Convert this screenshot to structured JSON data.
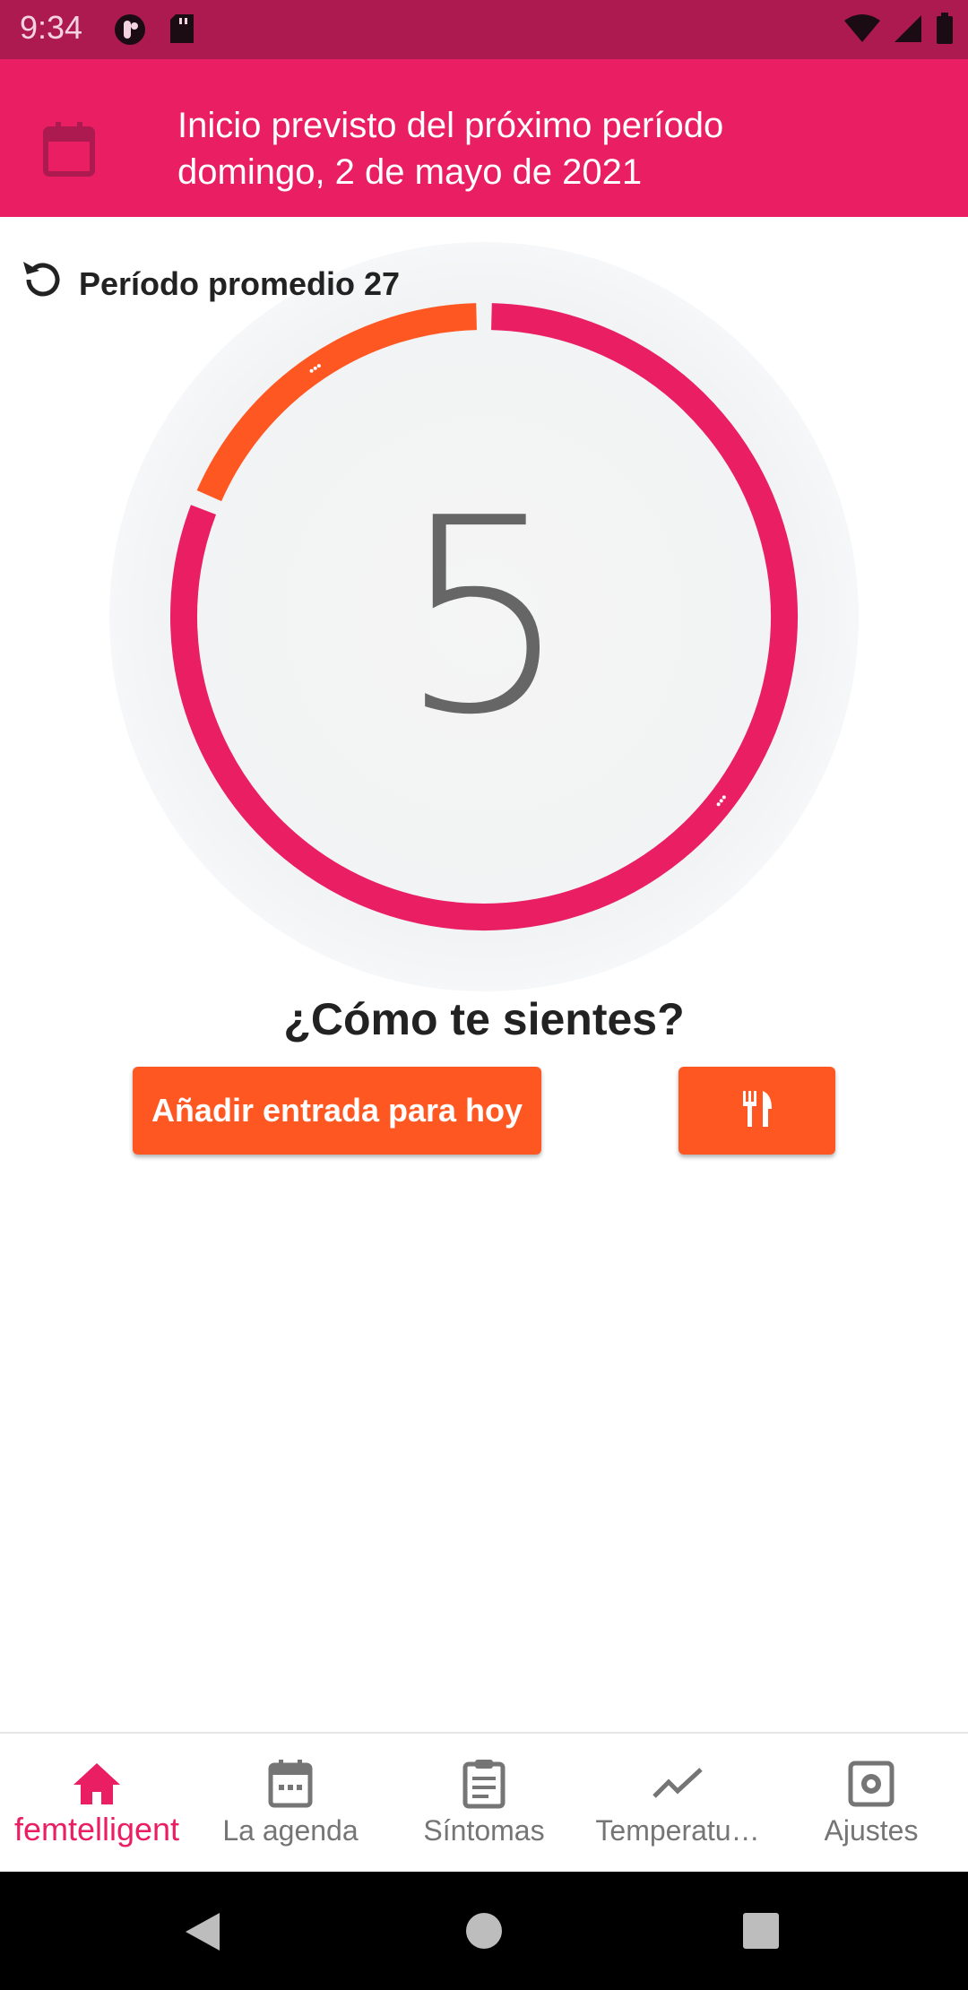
{
  "status_bar": {
    "time": "9:34",
    "icons_left": [
      "opera-icon",
      "sd-card-icon"
    ],
    "icons_right": [
      "wifi-icon",
      "signal-icon",
      "battery-icon"
    ]
  },
  "header": {
    "icon": "calendar-icon",
    "line1": "Inicio previsto del próximo período",
    "line2": "domingo, 2 de mayo de 2021"
  },
  "cycle": {
    "average_label": "Período promedio 27",
    "current_day": "5",
    "cycle_length_days": 27,
    "fertile_window_fraction_start": 0.812,
    "fertile_window_fraction_end": 1.0
  },
  "question": "¿Cómo te sientes?",
  "actions": {
    "add_entry_label": "Añadir entrada para hoy",
    "food_icon": "fork-knife-icon"
  },
  "bottom_nav": {
    "items": [
      {
        "label": "femtelligent",
        "icon": "home-icon",
        "active": true
      },
      {
        "label": "La agenda",
        "icon": "calendar-icon",
        "active": false
      },
      {
        "label": "Síntomas",
        "icon": "clipboard-icon",
        "active": false
      },
      {
        "label": "Temperatu…",
        "icon": "trend-icon",
        "active": false
      },
      {
        "label": "Ajustes",
        "icon": "settings-icon",
        "active": false
      }
    ]
  },
  "colors": {
    "status_bar": "#ad1a4f",
    "header": "#e91e63",
    "ring_primary": "#e91e63",
    "ring_fertile": "#ff5722",
    "button": "#ff5722",
    "nav_active": "#e91e63",
    "nav_inactive": "#757575"
  }
}
